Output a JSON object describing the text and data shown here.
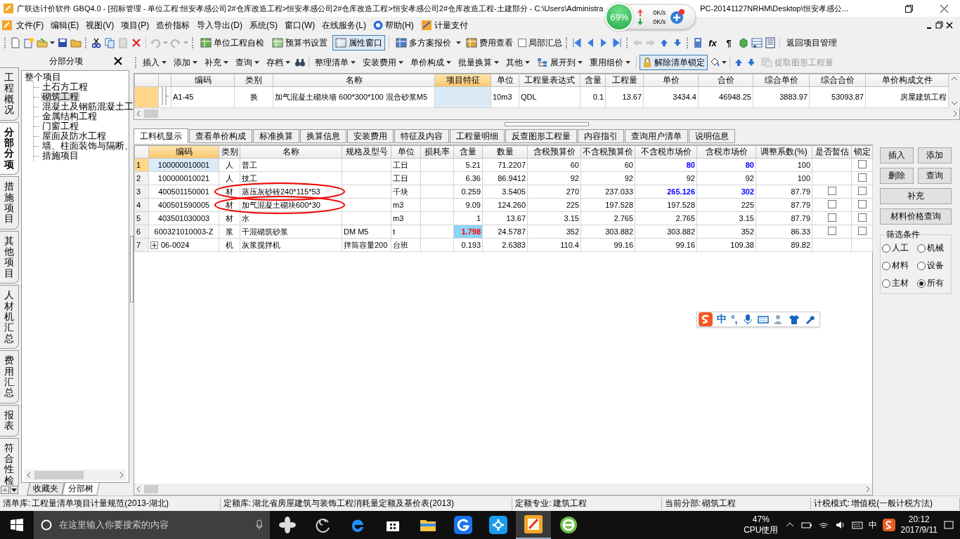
{
  "window": {
    "title": "广联达计价软件 GBQ4.0 - [招标管理 - 单位工程:恒安孝感公司2#仓库改造工程>恒安孝感公司2#仓库改造工程>恒安孝感公司2#仓库改造工程-土建部分 - C:\\Users\\Administra",
    "title_continued": "PC-20141127NRHM\\Desktop\\恒安孝感公..."
  },
  "net_monitor": {
    "percent": "69%",
    "upload": "0K/s",
    "download": "0K/s"
  },
  "menu": [
    "文件(F)",
    "编辑(E)",
    "视图(V)",
    "项目(P)",
    "造价指标",
    "导入导出(D)",
    "系统(S)",
    "窗口(W)",
    "在线服务(L)",
    "帮助(H)",
    "计量支付"
  ],
  "toolbar": {
    "buttons": [
      {
        "label": "单位工程自检",
        "pressed": false
      },
      {
        "label": "预算书设置",
        "pressed": false
      },
      {
        "label": "属性窗口",
        "pressed": true
      },
      {
        "label": "多方案报价",
        "pressed": false
      },
      {
        "label": "费用查看",
        "pressed": false
      }
    ],
    "checkbox": {
      "label": "局部汇总",
      "checked": false
    },
    "glyphs": [
      "fx",
      "¶"
    ],
    "return_button": "返回项目管理"
  },
  "side_tabs": [
    {
      "label": "工程概况",
      "selected": false
    },
    {
      "label": "分部分项",
      "selected": true
    },
    {
      "label": "措施项目",
      "selected": false
    },
    {
      "label": "其他项目",
      "selected": false
    },
    {
      "label": "人材机汇总",
      "selected": false
    },
    {
      "label": "费用汇总",
      "selected": false
    },
    {
      "label": "报表",
      "selected": false
    },
    {
      "label": "符合性检",
      "selected": false
    }
  ],
  "tree_panel": {
    "title": "分部分项",
    "root": "整个项目",
    "children": [
      {
        "label": "土石方工程",
        "selected": false
      },
      {
        "label": "砌筑工程",
        "selected": true
      },
      {
        "label": "混凝土及钢筋混凝土工",
        "selected": false
      },
      {
        "label": "金属结构工程",
        "selected": false
      },
      {
        "label": "门窗工程",
        "selected": false
      },
      {
        "label": "屋面及防水工程",
        "selected": false
      },
      {
        "label": "墙、柱面装饰与隔断、",
        "selected": false
      },
      {
        "label": "措施项目",
        "selected": false
      }
    ],
    "tabs": [
      {
        "label": "收藏夹",
        "selected": false
      },
      {
        "label": "分部树",
        "selected": true
      }
    ]
  },
  "edit_toolbar": {
    "group1": [
      "插入",
      "添加",
      "补充",
      "查询",
      "存档"
    ],
    "group2": [
      "整理清单",
      "安装费用",
      "单价构成",
      "批量换算",
      "其他",
      "展开到",
      "重用组价"
    ],
    "unlock": {
      "label": "解除清单锁定",
      "pressed": true
    },
    "extract": {
      "label": "提取图形工程量",
      "disabled": true
    }
  },
  "bill_grid": {
    "columns": [
      {
        "label": "编码",
        "selected": false
      },
      {
        "label": "类别",
        "selected": false
      },
      {
        "label": "名称",
        "selected": false
      },
      {
        "label": "项目特征",
        "selected": true
      },
      {
        "label": "单位",
        "selected": false
      },
      {
        "label": "工程量表达式",
        "selected": false
      },
      {
        "label": "含量",
        "selected": false
      },
      {
        "label": "工程量",
        "selected": false
      },
      {
        "label": "单价",
        "selected": false
      },
      {
        "label": "合价",
        "selected": false
      },
      {
        "label": "综合单价",
        "selected": false
      },
      {
        "label": "综合合价",
        "selected": false
      },
      {
        "label": "单价构成文件",
        "selected": false
      }
    ],
    "rows": [
      {
        "code": "A1-45",
        "type": "换",
        "name": "加气混凝土砌块墙 600*300*100 混合砂浆M5",
        "unit": "10m3",
        "expression": "QDL",
        "content": "0.1",
        "quantity": "13.67",
        "price": "3434.4",
        "total": "46948.25",
        "unit_cost": "3883.97",
        "total_cost": "53093.87",
        "template": "房屋建筑工程",
        "selected": true
      }
    ]
  },
  "detail_tabs": [
    {
      "label": "工料机显示",
      "selected": true
    },
    {
      "label": "查看单价构成",
      "selected": false
    },
    {
      "label": "标准换算",
      "selected": false
    },
    {
      "label": "换算信息",
      "selected": false
    },
    {
      "label": "安装费用",
      "selected": false
    },
    {
      "label": "特征及内容",
      "selected": false
    },
    {
      "label": "工程量明细",
      "selected": false
    },
    {
      "label": "反查图形工程量",
      "selected": false
    },
    {
      "label": "内容指引",
      "selected": false
    },
    {
      "label": "查询用户清单",
      "selected": false
    },
    {
      "label": "说明信息",
      "selected": false
    }
  ],
  "detail_grid": {
    "columns": [
      {
        "label": "编码",
        "selected": true
      },
      {
        "label": "类别",
        "selected": false
      },
      {
        "label": "名称",
        "selected": false
      },
      {
        "label": "规格及型号",
        "selected": false
      },
      {
        "label": "单位",
        "selected": false
      },
      {
        "label": "损耗率",
        "selected": false
      },
      {
        "label": "含量",
        "selected": false
      },
      {
        "label": "数量",
        "selected": false
      },
      {
        "label": "含税预算价",
        "selected": false
      },
      {
        "label": "不含税预算价",
        "selected": false
      },
      {
        "label": "不含税市场价",
        "selected": false
      },
      {
        "label": "含税市场价",
        "selected": false
      },
      {
        "label": "调整系数(%)",
        "selected": false
      },
      {
        "label": "是否暂估",
        "selected": false
      },
      {
        "label": "锁定",
        "selected": false
      }
    ],
    "rows": [
      {
        "no": "1",
        "code": "100000010001",
        "type": "人",
        "name": "普工",
        "unit": "工日",
        "content": "5.21",
        "quantity": "71.2207",
        "tax_budget": "60",
        "budget": "60",
        "market": "80",
        "tax_market": "80",
        "factor": "100",
        "locked": false,
        "selected": true,
        "market_changed": true,
        "content_changed": false,
        "circled": false
      },
      {
        "no": "2",
        "code": "100000010021",
        "type": "人",
        "name": "技工",
        "unit": "工日",
        "content": "6.36",
        "quantity": "86.9412",
        "tax_budget": "92",
        "budget": "92",
        "market": "92",
        "tax_market": "92",
        "factor": "100",
        "locked": false,
        "selected": false,
        "market_changed": false,
        "content_changed": false,
        "circled": false
      },
      {
        "no": "3",
        "code": "400501150001",
        "type": "材",
        "name": "蒸压灰砂砖240*115*53",
        "unit": "千块",
        "content": "0.259",
        "quantity": "3.5405",
        "tax_budget": "270",
        "budget": "237.033",
        "market": "265.126",
        "tax_market": "302",
        "factor": "87.79",
        "estimate": false,
        "locked": false,
        "selected": false,
        "market_changed": true,
        "content_changed": false,
        "circled": true
      },
      {
        "no": "4",
        "code": "400501590005",
        "type": "材",
        "name": "加气混凝土砌块600*30",
        "unit": "m3",
        "content": "9.09",
        "quantity": "124.260",
        "tax_budget": "225",
        "budget": "197.528",
        "market": "197.528",
        "tax_market": "225",
        "factor": "87.79",
        "estimate": false,
        "locked": false,
        "selected": false,
        "market_changed": false,
        "content_changed": false,
        "circled": true
      },
      {
        "no": "5",
        "code": "403501030003",
        "type": "材",
        "name": "水",
        "unit": "m3",
        "content": "1",
        "quantity": "13.67",
        "tax_budget": "3.15",
        "budget": "2.765",
        "market": "2.765",
        "tax_market": "3.15",
        "factor": "87.79",
        "estimate": false,
        "locked": false,
        "selected": false,
        "market_changed": false,
        "content_changed": false,
        "circled": false
      },
      {
        "no": "6",
        "code": "600321010003-Z",
        "type": "浆",
        "name": "干混砌筑砂浆",
        "spec": "DM M5",
        "unit": "t",
        "content": "1.798",
        "quantity": "24.5787",
        "tax_budget": "352",
        "budget": "303.882",
        "market": "303.882",
        "tax_market": "352",
        "factor": "86.33",
        "estimate": false,
        "locked": false,
        "selected": false,
        "market_changed": false,
        "content_changed": true,
        "circled": false
      },
      {
        "no": "7",
        "code": "06-0024",
        "type": "机",
        "name": "灰浆搅拌机",
        "spec": "拌筒容量200",
        "unit": "台班",
        "content": "0.193",
        "quantity": "2.6383",
        "tax_budget": "110.4",
        "budget": "99.16",
        "market": "99.16",
        "tax_market": "109.38",
        "factor": "89.82",
        "expanded": false,
        "selected": false,
        "market_changed": false,
        "content_changed": false,
        "circled": false
      }
    ]
  },
  "right_panel": {
    "buttons": [
      "插入",
      "添加",
      "删除",
      "查询",
      "补充",
      "材料价格查询"
    ],
    "filter": {
      "title": "筛选条件",
      "options": [
        {
          "label": "人工",
          "selected": false
        },
        {
          "label": "机械",
          "selected": false
        },
        {
          "label": "材料",
          "selected": false
        },
        {
          "label": "设备",
          "selected": false
        },
        {
          "label": "主材",
          "selected": false
        },
        {
          "label": "所有",
          "selected": true
        }
      ]
    }
  },
  "ime_bar": {
    "mode": "中",
    "punct": "°,"
  },
  "status_bar": [
    {
      "label": "清单库:",
      "value": "工程量清单项目计量规范(2013-湖北)"
    },
    {
      "label": "定额库:",
      "value": "湖北省房屋建筑与装饰工程消耗量定额及基价表(2013)"
    },
    {
      "label": "定额专业:",
      "value": "建筑工程"
    },
    {
      "label": "当前分部:",
      "value": "砌筑工程"
    },
    {
      "label": "计税模式:",
      "value": "增值税(一般计税方法)"
    }
  ],
  "taskbar": {
    "search_placeholder": "在这里输入你要搜索的内容",
    "cpu": "47%",
    "cpu_label": "CPU使用",
    "input_method": "中",
    "time": "20:12",
    "date": "2017/9/11"
  }
}
